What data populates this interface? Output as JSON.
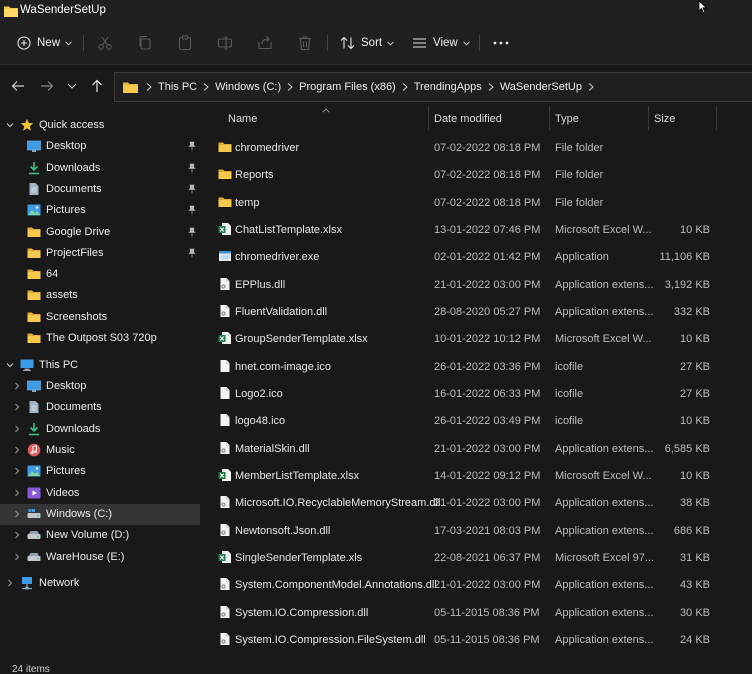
{
  "window": {
    "title": "WaSenderSetUp"
  },
  "toolbar": {
    "new_label": "New",
    "sort_label": "Sort",
    "view_label": "View",
    "icons": [
      "cut-icon",
      "copy-icon",
      "paste-icon",
      "rename-icon",
      "share-icon",
      "delete-icon"
    ]
  },
  "address": {
    "breadcrumbs": [
      "This PC",
      "Windows (C:)",
      "Program Files (x86)",
      "TrendingApps",
      "WaSenderSetUp"
    ]
  },
  "sidebar": {
    "quick_access": "Quick access",
    "quick_items": [
      {
        "label": "Desktop",
        "icon": "desktop-icon"
      },
      {
        "label": "Downloads",
        "icon": "download-icon"
      },
      {
        "label": "Documents",
        "icon": "document-icon"
      },
      {
        "label": "Pictures",
        "icon": "pictures-icon"
      },
      {
        "label": "Google Drive",
        "icon": "folder-icon"
      },
      {
        "label": "ProjectFiles",
        "icon": "folder-icon"
      },
      {
        "label": "64",
        "icon": "folder-icon"
      },
      {
        "label": "assets",
        "icon": "folder-icon"
      },
      {
        "label": "Screenshots",
        "icon": "folder-icon"
      },
      {
        "label": "The Outpost S03 720p",
        "icon": "folder-icon"
      }
    ],
    "this_pc": "This PC",
    "pc_items": [
      {
        "label": "Desktop",
        "icon": "desktop-icon"
      },
      {
        "label": "Documents",
        "icon": "document-icon"
      },
      {
        "label": "Downloads",
        "icon": "download-icon"
      },
      {
        "label": "Music",
        "icon": "music-icon"
      },
      {
        "label": "Pictures",
        "icon": "pictures-icon"
      },
      {
        "label": "Videos",
        "icon": "videos-icon"
      },
      {
        "label": "Windows (C:)",
        "icon": "drive-icon"
      },
      {
        "label": "New Volume (D:)",
        "icon": "drive-icon"
      },
      {
        "label": "WareHouse (E:)",
        "icon": "drive-icon"
      }
    ],
    "network": "Network"
  },
  "columns": {
    "name": "Name",
    "date": "Date modified",
    "type": "Type",
    "size": "Size"
  },
  "files": [
    {
      "name": "chromedriver",
      "date": "07-02-2022 08:18 PM",
      "type": "File folder",
      "size": "",
      "icon": "folder"
    },
    {
      "name": "Reports",
      "date": "07-02-2022 08:18 PM",
      "type": "File folder",
      "size": "",
      "icon": "folder"
    },
    {
      "name": "temp",
      "date": "07-02-2022 08:18 PM",
      "type": "File folder",
      "size": "",
      "icon": "folder"
    },
    {
      "name": "ChatListTemplate.xlsx",
      "date": "13-01-2022 07:46 PM",
      "type": "Microsoft Excel W...",
      "size": "10 KB",
      "icon": "excel"
    },
    {
      "name": "chromedriver.exe",
      "date": "02-01-2022 01:42 PM",
      "type": "Application",
      "size": "11,106 KB",
      "icon": "exe"
    },
    {
      "name": "EPPlus.dll",
      "date": "21-01-2022 03:00 PM",
      "type": "Application extens...",
      "size": "3,192 KB",
      "icon": "dll"
    },
    {
      "name": "FluentValidation.dll",
      "date": "28-08-2020 05:27 PM",
      "type": "Application extens...",
      "size": "332 KB",
      "icon": "dll"
    },
    {
      "name": "GroupSenderTemplate.xlsx",
      "date": "10-01-2022 10:12 PM",
      "type": "Microsoft Excel W...",
      "size": "10 KB",
      "icon": "excel"
    },
    {
      "name": "hnet.com-image.ico",
      "date": "26-01-2022 03:36 PM",
      "type": "icofile",
      "size": "27 KB",
      "icon": "file"
    },
    {
      "name": "Logo2.ico",
      "date": "16-01-2022 06:33 PM",
      "type": "icofile",
      "size": "27 KB",
      "icon": "file"
    },
    {
      "name": "logo48.ico",
      "date": "26-01-2022 03:49 PM",
      "type": "icofile",
      "size": "10 KB",
      "icon": "file"
    },
    {
      "name": "MaterialSkin.dll",
      "date": "21-01-2022 03:00 PM",
      "type": "Application extens...",
      "size": "6,585 KB",
      "icon": "dll"
    },
    {
      "name": "MemberListTemplate.xlsx",
      "date": "14-01-2022 09:12 PM",
      "type": "Microsoft Excel W...",
      "size": "10 KB",
      "icon": "excel"
    },
    {
      "name": "Microsoft.IO.RecyclableMemoryStream.dll",
      "date": "21-01-2022 03:00 PM",
      "type": "Application extens...",
      "size": "38 KB",
      "icon": "dll"
    },
    {
      "name": "Newtonsoft.Json.dll",
      "date": "17-03-2021 08:03 PM",
      "type": "Application extens...",
      "size": "686 KB",
      "icon": "dll"
    },
    {
      "name": "SingleSenderTemplate.xls",
      "date": "22-08-2021 06:37 PM",
      "type": "Microsoft Excel 97...",
      "size": "31 KB",
      "icon": "excel"
    },
    {
      "name": "System.ComponentModel.Annotations.dll",
      "date": "21-01-2022 03:00 PM",
      "type": "Application extens...",
      "size": "43 KB",
      "icon": "dll"
    },
    {
      "name": "System.IO.Compression.dll",
      "date": "05-11-2015 08:36 PM",
      "type": "Application extens...",
      "size": "30 KB",
      "icon": "dll"
    },
    {
      "name": "System.IO.Compression.FileSystem.dll",
      "date": "05-11-2015 08:36 PM",
      "type": "Application extens...",
      "size": "24 KB",
      "icon": "dll"
    }
  ],
  "status": {
    "items": "24 items"
  },
  "colors": {
    "folder": "#f6c84c",
    "excel": "#1f7a45",
    "accent": "#4aa3ff"
  }
}
